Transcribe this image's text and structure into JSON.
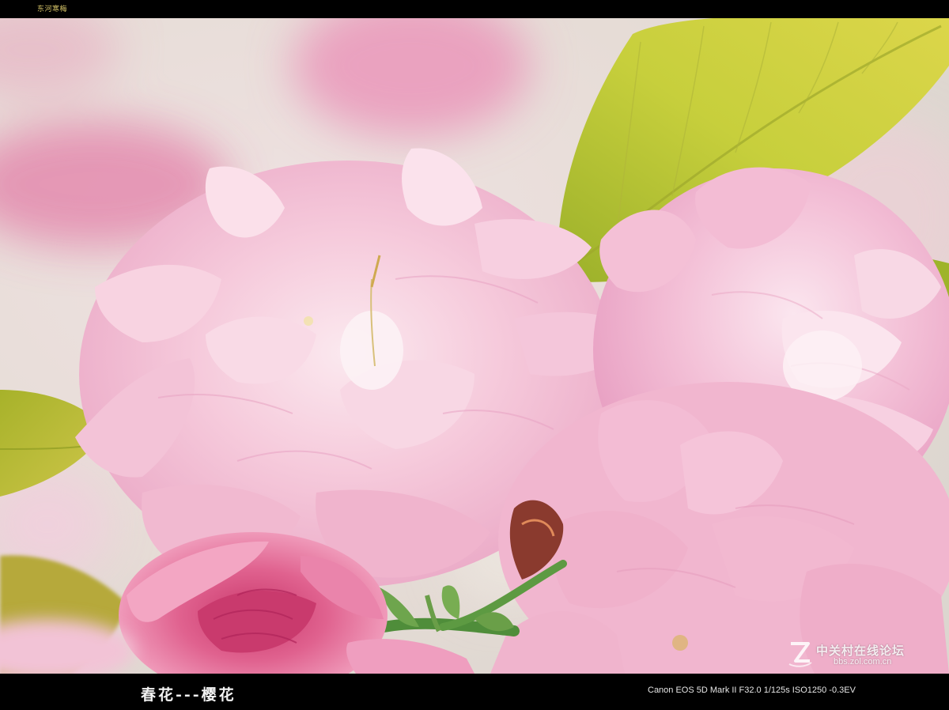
{
  "author": "东河寒梅",
  "caption": "春花---樱花",
  "exif": "Canon EOS 5D Mark II F32.0 1/125s ISO1250 -0.3EV",
  "watermark": {
    "line1": "中关村在线论坛",
    "line2": "bbs.zol.com.cn"
  },
  "colors": {
    "frame": "#000000",
    "blossom_light": "#f6c9dc",
    "blossom_mid": "#eeaac8",
    "blossom_deep": "#d9507f",
    "leaf_yellow_green": "#c9cf3a",
    "leaf_green": "#8fae24",
    "background": "#e8dcd8"
  }
}
